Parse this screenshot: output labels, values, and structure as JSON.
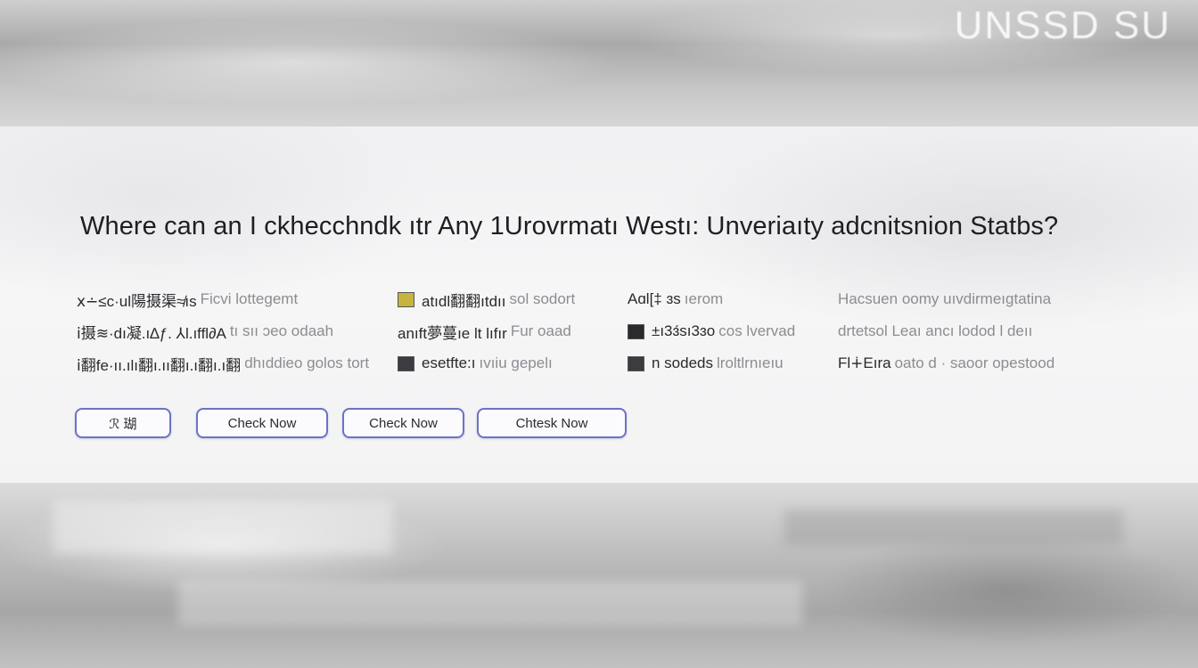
{
  "background": {
    "top_watermark": "UNSSD SU"
  },
  "question": {
    "title": "Where can an I ckhecchndk ıtr  Any  1Urovrmatı Westı: Unveriaıty adcnitsnion Statbs?"
  },
  "options": {
    "col1": [
      {
        "dark": "ⅹ∸≤c·ul陽摄渠≉ıs",
        "light": "Ficvi lottegemt"
      },
      {
        "dark": "ⅰ摄≋·dı凝.ı∆ƒ. ⅄l.ıffl∂A",
        "light": "tı sıı ɔeo odaah"
      },
      {
        "dark": "ⅰ翻fe·ıı.ılı翻ı.ıı翻ı.ı翻ı.ı翻",
        "light": "dhıddieo golos tort"
      }
    ],
    "col2": [
      {
        "dark": "atıdl翻翻ıtdıı",
        "light": "sol sodort"
      },
      {
        "dark": "anıft夢蔓ıe lt lıfır",
        "light": "Fur oaad"
      },
      {
        "dark": "esetfte:ı",
        "light": "ıvıiu gepelı"
      }
    ],
    "col3": [
      {
        "dark": "Aɑl[‡ ɜs",
        "light": "ıerom"
      },
      {
        "dark": "±ı3ɜ́sı3ɜo",
        "light": "cos lvervad"
      },
      {
        "dark": "n sodeds",
        "light": "lroltlrnıeıu"
      }
    ],
    "col4": [
      {
        "dark": "",
        "light": "Hacsuen oomy uıvdirmeıgtatina"
      },
      {
        "dark": "",
        "light": "drtetsol Leaı ancı lodod l deıı"
      },
      {
        "dark": "Fl∔Eıra",
        "light": "oato d · saoor opestood"
      }
    ]
  },
  "buttons": [
    {
      "label": "ℛ  瑚"
    },
    {
      "label": "Check Now"
    },
    {
      "label": "Check Now"
    },
    {
      "label": "Chtesk Now"
    }
  ]
}
